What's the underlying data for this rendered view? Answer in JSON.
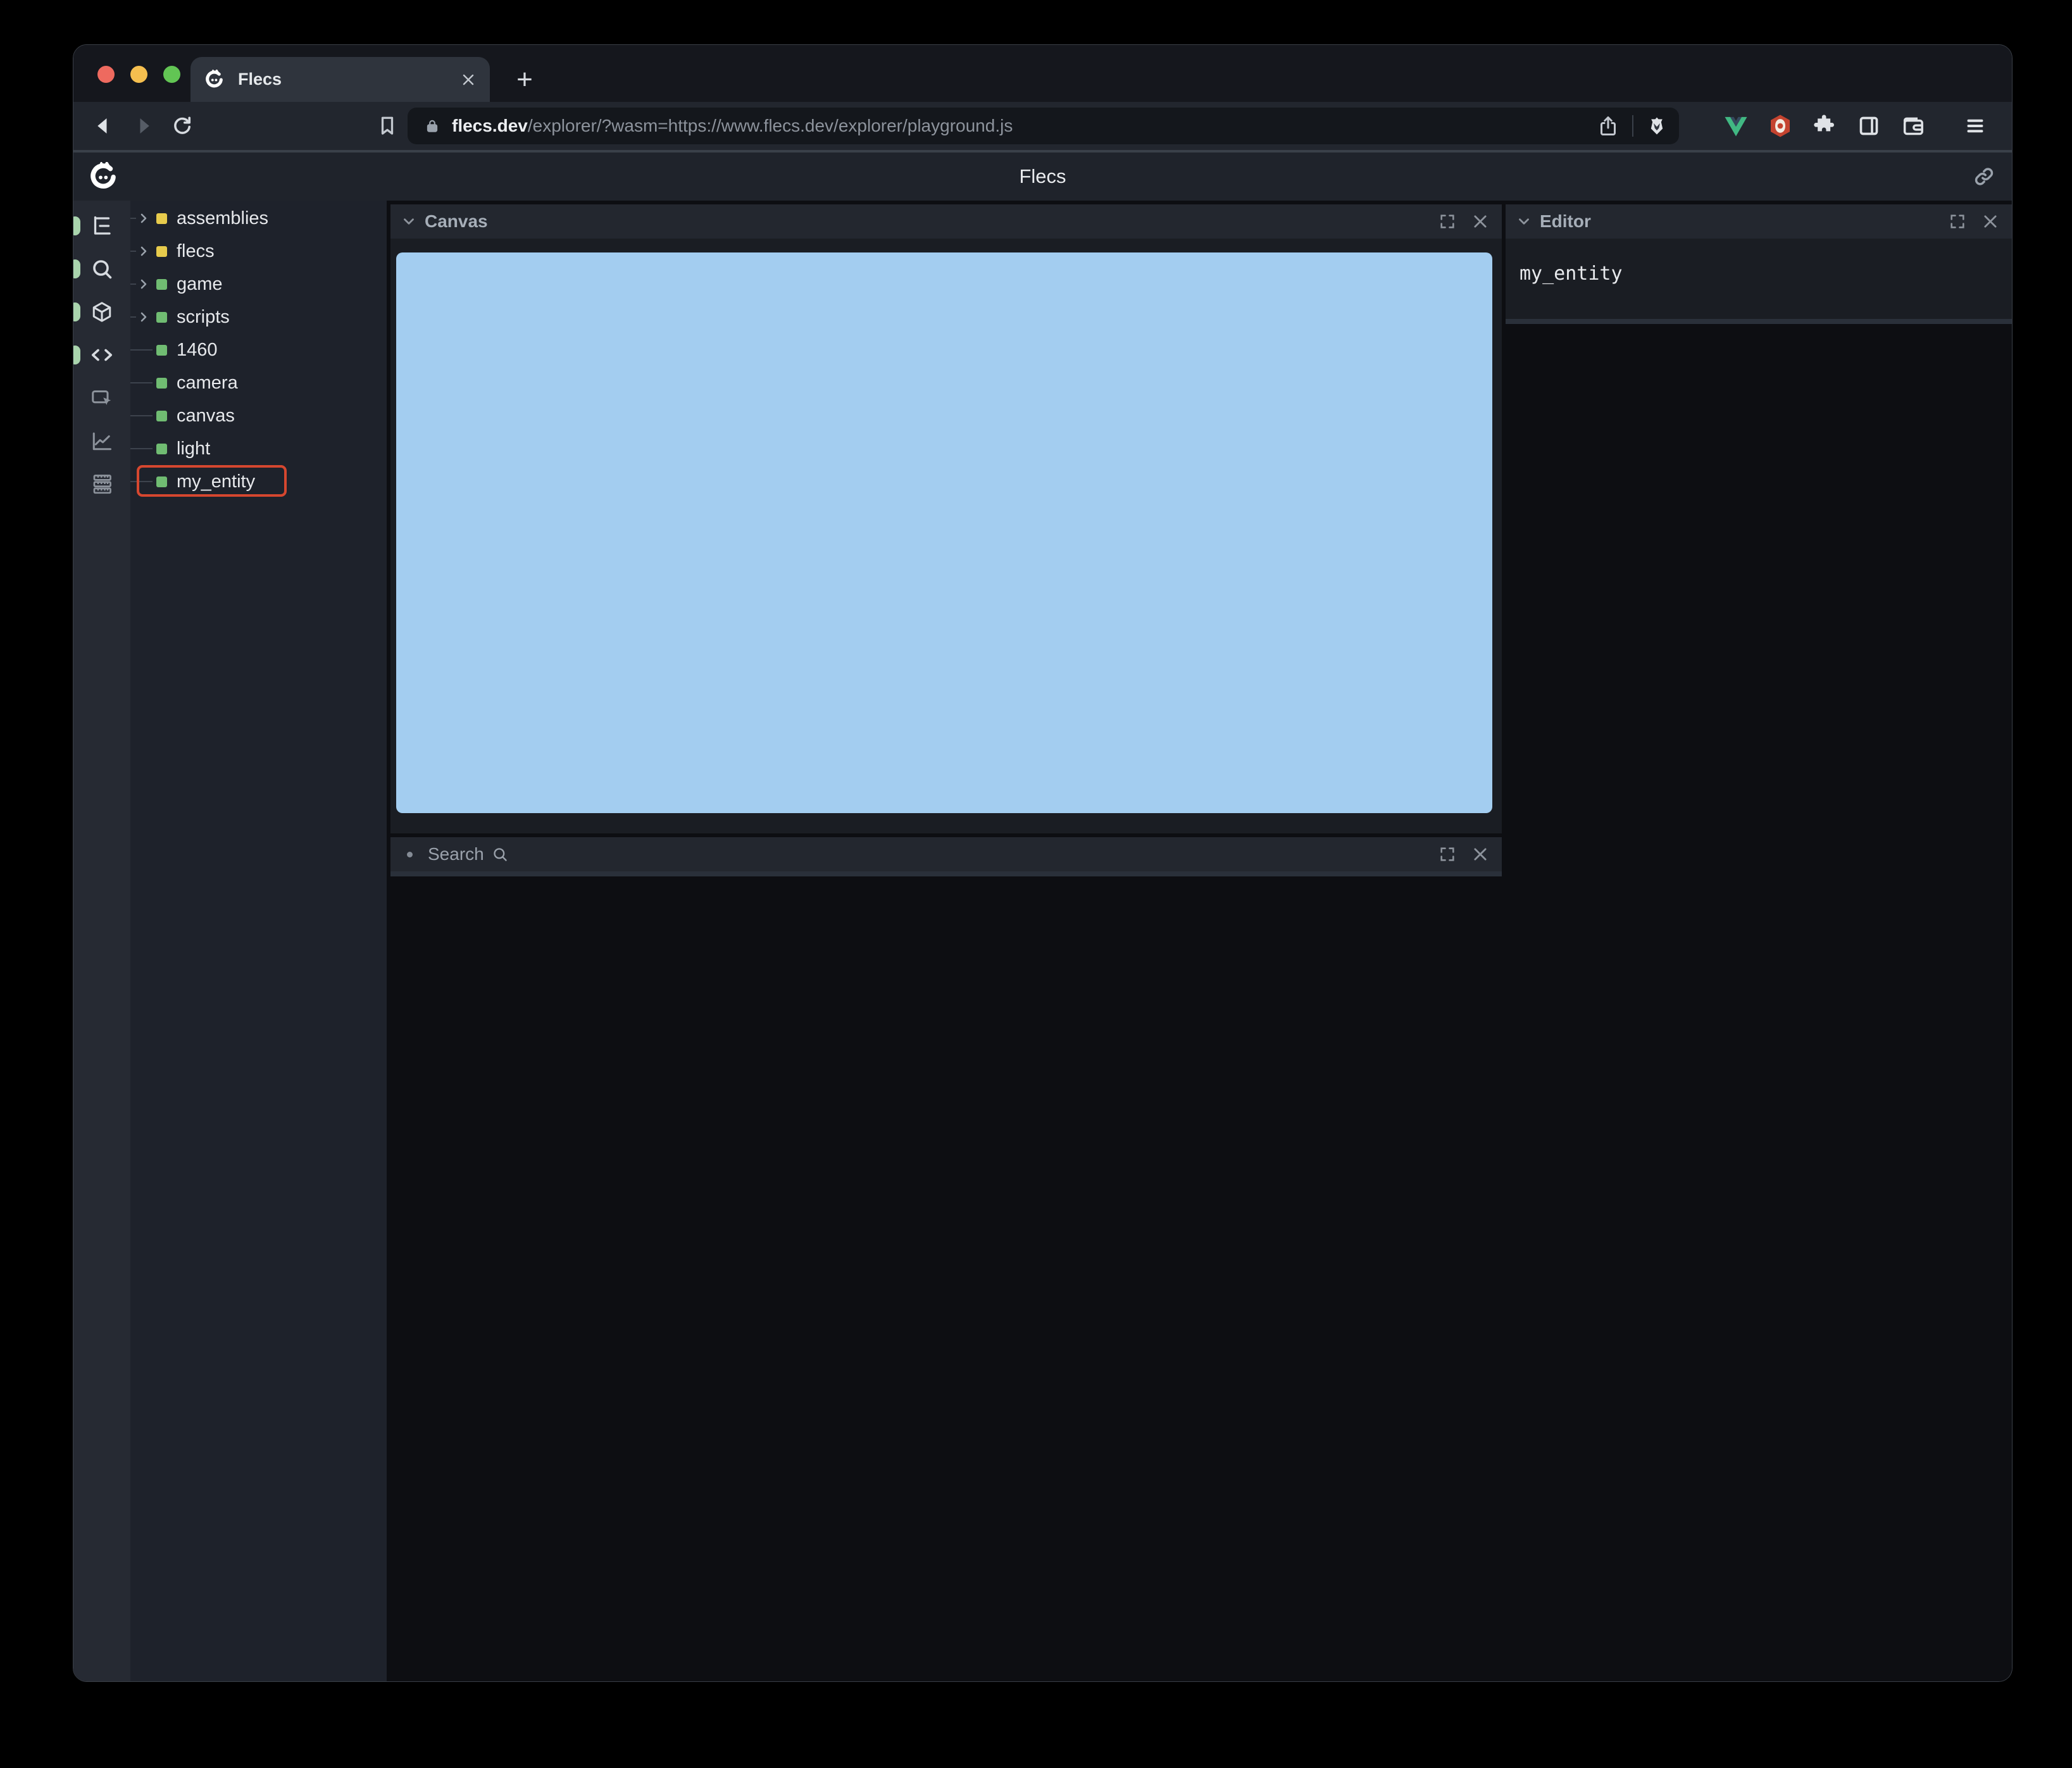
{
  "browser": {
    "tab_title": "Flecs",
    "new_tab_label": "+",
    "url": {
      "domain": "flecs.dev",
      "path": "/explorer/?wasm=https://www.flecs.dev/explorer/playground.js"
    }
  },
  "app": {
    "title": "Flecs",
    "sidebar_icons": [
      "tree",
      "search",
      "cube",
      "code",
      "inspect",
      "chart",
      "stats"
    ],
    "tree": {
      "items": [
        {
          "label": "assemblies",
          "square": "yellow",
          "expandable": true
        },
        {
          "label": "flecs",
          "square": "yellow",
          "expandable": true
        },
        {
          "label": "game",
          "square": "green",
          "expandable": true
        },
        {
          "label": "scripts",
          "square": "green",
          "expandable": true
        },
        {
          "label": "1460",
          "square": "green",
          "expandable": false
        },
        {
          "label": "camera",
          "square": "green",
          "expandable": false
        },
        {
          "label": "canvas",
          "square": "green",
          "expandable": false
        },
        {
          "label": "light",
          "square": "green",
          "expandable": false
        },
        {
          "label": "my_entity",
          "square": "green",
          "expandable": false,
          "selected": true
        }
      ]
    },
    "canvas_panel": {
      "title": "Canvas"
    },
    "search_panel": {
      "label": "Search"
    },
    "editor_panel": {
      "title": "Editor",
      "content": "my_entity"
    }
  },
  "colors": {
    "canvas_blue": "#a3cdf0",
    "square_green": "#70bc72",
    "square_yellow": "#e7cb4c",
    "selection_highlight_red": "#d6472f",
    "active_pill_green": "#a9d4ad",
    "traffic_red": "#ee6a5f",
    "traffic_yellow": "#f5bf4f",
    "traffic_green": "#62c554",
    "vue_green": "#41b883"
  }
}
